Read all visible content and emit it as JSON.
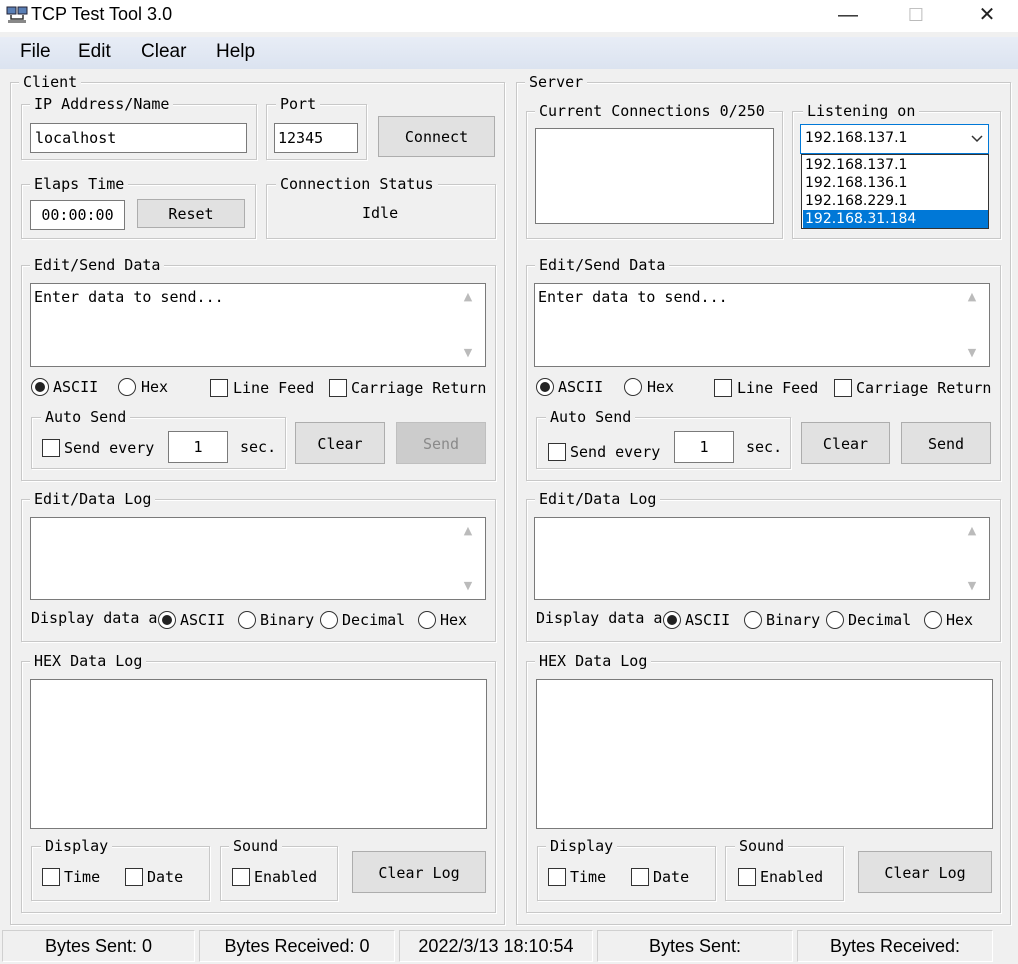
{
  "window": {
    "title": "TCP Test Tool 3.0",
    "minimize": "—",
    "maximize": "☐",
    "close": "✕"
  },
  "menu": [
    "File",
    "Edit",
    "Clear",
    "Help"
  ],
  "client": {
    "group": "Client",
    "ip_label": "IP Address/Name",
    "ip_value": "localhost",
    "port_label": "Port",
    "port_value": "12345",
    "connect": "Connect",
    "elaps_label": "Elaps Time",
    "elaps_value": "00:00:00",
    "reset": "Reset",
    "conn_status_label": "Connection Status",
    "conn_status_value": "Idle",
    "edit_send_label": "Edit/Send Data",
    "send_placeholder": "Enter data to send...",
    "fmt_ascii": "ASCII",
    "fmt_hex": "Hex",
    "line_feed": "Line Feed",
    "carriage_return": "Carriage Return",
    "auto_send_label": "Auto Send",
    "send_every": "Send every",
    "send_every_value": "1",
    "sec": "sec.",
    "clear": "Clear",
    "send": "Send",
    "data_log_label": "Edit/Data Log",
    "display_data": "Display data a",
    "disp_ascii": "ASCII",
    "disp_binary": "Binary",
    "disp_decimal": "Decimal",
    "disp_hex": "Hex",
    "hex_log_label": "HEX Data Log",
    "display_label": "Display",
    "time": "Time",
    "date": "Date",
    "sound_label": "Sound",
    "enabled": "Enabled",
    "clear_log": "Clear Log"
  },
  "server": {
    "group": "Server",
    "connections_label": "Current Connections 0/250",
    "listening_label": "Listening on",
    "listening_value": "192.168.137.1",
    "listening_options": [
      "192.168.137.1",
      "192.168.136.1",
      "192.168.229.1",
      "192.168.31.184"
    ],
    "edit_send_label": "Edit/Send Data",
    "send_placeholder": "Enter data to send...",
    "fmt_ascii": "ASCII",
    "fmt_hex": "Hex",
    "line_feed": "Line Feed",
    "carriage_return": "Carriage Return",
    "auto_send_label": "Auto Send",
    "send_every": "Send every",
    "send_every_value": "1",
    "sec": "sec.",
    "clear": "Clear",
    "send": "Send",
    "data_log_label": "Edit/Data Log",
    "display_data": "Display data a",
    "disp_ascii": "ASCII",
    "disp_binary": "Binary",
    "disp_decimal": "Decimal",
    "disp_hex": "Hex",
    "hex_log_label": "HEX Data Log",
    "display_label": "Display",
    "time": "Time",
    "date": "Date",
    "sound_label": "Sound",
    "enabled": "Enabled",
    "clear_log": "Clear Log"
  },
  "status": {
    "bytes_sent": "Bytes Sent: 0",
    "bytes_received": "Bytes Received: 0",
    "datetime": "2022/3/13 18:10:54",
    "srv_bytes_sent": "Bytes Sent:",
    "srv_bytes_received": "Bytes Received:"
  },
  "icons": {
    "app": "network-computers-icon",
    "scroll_up": "scroll-up-arrow-icon",
    "scroll_down": "scroll-down-arrow-icon",
    "dropdown": "chevron-down-icon"
  },
  "colors": {
    "selection": "#0078d7",
    "menubar": "#dbe3f0",
    "face": "#f0f0f0"
  }
}
